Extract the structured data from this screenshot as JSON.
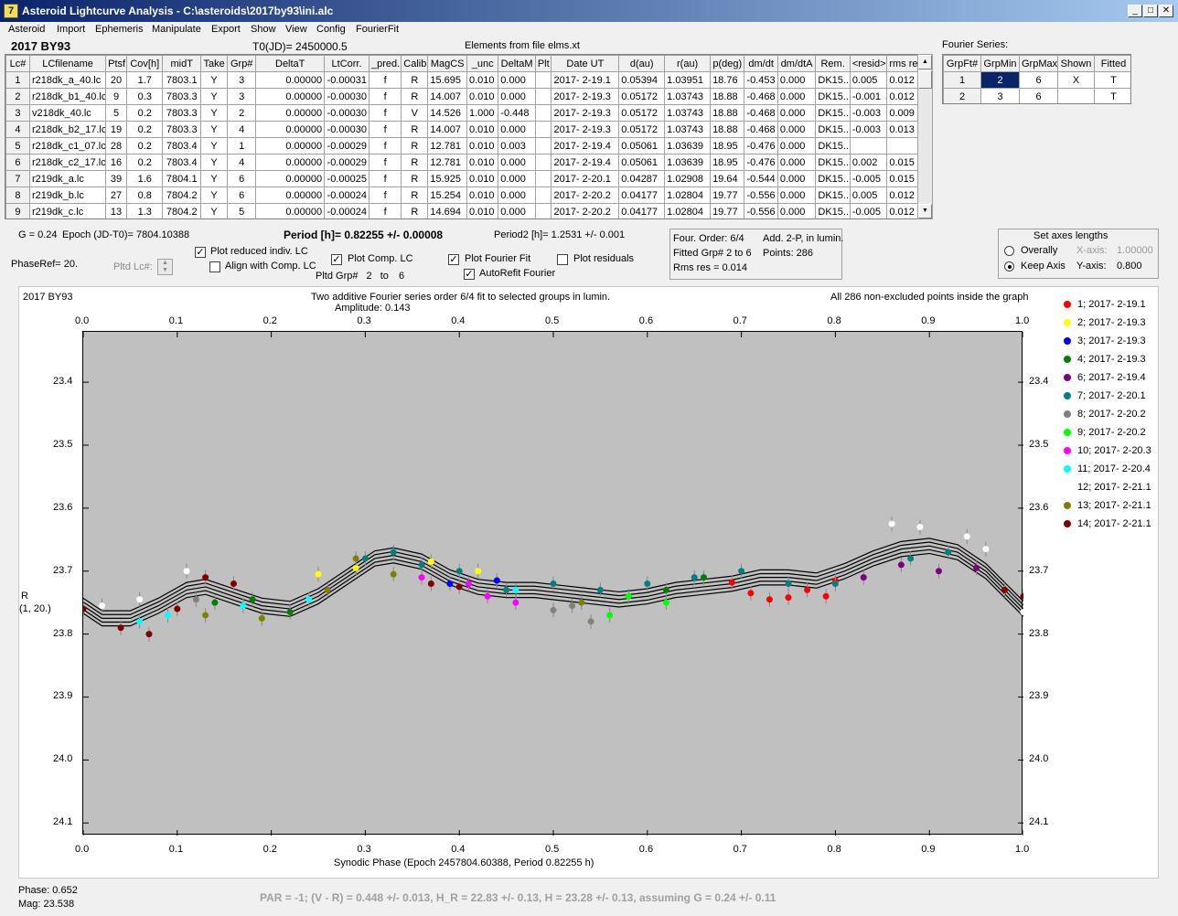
{
  "window": {
    "title": "Asteroid Lightcurve Analysis - C:\\asteroids\\2017by93\\ini.alc",
    "icon_letter": "7"
  },
  "menu": [
    "Asteroid",
    "Import",
    "Ephemeris",
    "Manipulate",
    "Export",
    "Show",
    "View",
    "Config",
    "FourierFit"
  ],
  "header": {
    "object": "2017 BY93",
    "t0": "T0(JD)= 2450000.5",
    "elements": "Elements from file elms.xt",
    "fourier_series": "Fourier Series:"
  },
  "lc_table": {
    "columns": [
      "Lc#",
      "LCfilename",
      "Ptsf",
      "Cov[h]",
      "midT",
      "Take",
      "Grp#",
      "DeltaT",
      "LtCorr.",
      "_pred.",
      "Calib.",
      "MagCS",
      "_unc",
      "DeltaM",
      "Plt",
      "Date UT",
      "d(au)",
      "r(au)",
      "p(deg)",
      "dm/dt",
      "dm/dtA",
      "Rem.",
      "<resid>",
      "rms res"
    ],
    "rows": [
      [
        "1",
        "r218dk_a_40.lc",
        "20",
        "1.7",
        "7803.1",
        "Y",
        "3",
        "0.00000",
        "-0.00031",
        "f",
        "R",
        "15.695",
        "0.010",
        "0.000",
        "",
        "2017- 2-19.1",
        "0.05394",
        "1.03951",
        "18.76",
        "-0.453",
        "0.000",
        "DK15...",
        "0.005",
        "0.012"
      ],
      [
        "2",
        "r218dk_b1_40.lc",
        "9",
        "0.3",
        "7803.3",
        "Y",
        "3",
        "0.00000",
        "-0.00030",
        "f",
        "R",
        "14.007",
        "0.010",
        "0.000",
        "",
        "2017- 2-19.3",
        "0.05172",
        "1.03743",
        "18.88",
        "-0.468",
        "0.000",
        "DK15...",
        "-0.001",
        "0.012"
      ],
      [
        "3",
        "v218dk_40.lc",
        "5",
        "0.2",
        "7803.3",
        "Y",
        "2",
        "0.00000",
        "-0.00030",
        "f",
        "V",
        "14.526",
        "1.000",
        "-0.448",
        "",
        "2017- 2-19.3",
        "0.05172",
        "1.03743",
        "18.88",
        "-0.468",
        "0.000",
        "DK15...",
        "-0.003",
        "0.009"
      ],
      [
        "4",
        "r218dk_b2_17.lc",
        "19",
        "0.2",
        "7803.3",
        "Y",
        "4",
        "0.00000",
        "-0.00030",
        "f",
        "R",
        "14.007",
        "0.010",
        "0.000",
        "",
        "2017- 2-19.3",
        "0.05172",
        "1.03743",
        "18.88",
        "-0.468",
        "0.000",
        "DK15...",
        "-0.003",
        "0.013"
      ],
      [
        "5",
        "r218dk_c1_07.lc",
        "28",
        "0.2",
        "7803.4",
        "Y",
        "1",
        "0.00000",
        "-0.00029",
        "f",
        "R",
        "12.781",
        "0.010",
        "0.003",
        "",
        "2017- 2-19.4",
        "0.05061",
        "1.03639",
        "18.95",
        "-0.476",
        "0.000",
        "DK15...",
        "",
        ""
      ],
      [
        "6",
        "r218dk_c2_17.lc",
        "16",
        "0.2",
        "7803.4",
        "Y",
        "4",
        "0.00000",
        "-0.00029",
        "f",
        "R",
        "12.781",
        "0.010",
        "0.000",
        "",
        "2017- 2-19.4",
        "0.05061",
        "1.03639",
        "18.95",
        "-0.476",
        "0.000",
        "DK15...",
        "0.002",
        "0.015"
      ],
      [
        "7",
        "r219dk_a.lc",
        "39",
        "1.6",
        "7804.1",
        "Y",
        "6",
        "0.00000",
        "-0.00025",
        "f",
        "R",
        "15.925",
        "0.010",
        "0.000",
        "",
        "2017- 2-20.1",
        "0.04287",
        "1.02908",
        "19.64",
        "-0.544",
        "0.000",
        "DK15...",
        "-0.005",
        "0.015"
      ],
      [
        "8",
        "r219dk_b.lc",
        "27",
        "0.8",
        "7804.2",
        "Y",
        "6",
        "0.00000",
        "-0.00024",
        "f",
        "R",
        "15.254",
        "0.010",
        "0.000",
        "",
        "2017- 2-20.2",
        "0.04177",
        "1.02804",
        "19.77",
        "-0.556",
        "0.000",
        "DK15...",
        "0.005",
        "0.012"
      ],
      [
        "9",
        "r219dk_c.lc",
        "13",
        "1.3",
        "7804.2",
        "Y",
        "5",
        "0.00000",
        "-0.00024",
        "f",
        "R",
        "14.694",
        "0.010",
        "0.000",
        "",
        "2017- 2-20.2",
        "0.04177",
        "1.02804",
        "19.77",
        "-0.556",
        "0.000",
        "DK15...",
        "-0.005",
        "0.012"
      ]
    ]
  },
  "fourier_table": {
    "columns": [
      "GrpFt#",
      "GrpMin",
      "GrpMax",
      "Shown",
      "Fitted"
    ],
    "rows": [
      [
        "1",
        "2",
        "6",
        "X",
        "T"
      ],
      [
        "2",
        "3",
        "6",
        "",
        "T"
      ]
    ]
  },
  "controls": {
    "g_value": "G = 0.24",
    "epoch": "Epoch (JD-T0)= 7804.10388",
    "period": "Period [h]= 0.82255 +/- 0.00008",
    "period2": "Period2 [h]= 1.2531 +/- 0.001",
    "phase_ref": "PhaseRef= 20.",
    "pltd_lc": "Pltd Lc#:",
    "plot_reduced": "Plot reduced indiv. LC",
    "align_comp": "Align with Comp. LC",
    "plot_comp": "Plot Comp. LC",
    "pltd_grp": "Pltd Grp#",
    "grp_from": "2",
    "grp_to_word": "to",
    "grp_to": "6",
    "plot_fourier": "Plot Fourier Fit",
    "autorefit": "AutoRefit Fourier",
    "plot_residuals": "Plot residuals",
    "checked": {
      "plot_reduced": true,
      "align_comp": false,
      "plot_comp": true,
      "plot_fourier": true,
      "autorefit": true,
      "plot_residuals": false
    }
  },
  "fit_info": {
    "four_order": "Four. Order:  6/4",
    "add": "Add. 2-P, in lumin.",
    "fitted_grp": "Fitted Grp# 2 to 6",
    "points": "Points: 286",
    "rms": "Rms res     = 0.014"
  },
  "axes_box": {
    "title": "Set axes lengths",
    "overally": "Overally",
    "keep_axis": "Keep Axis",
    "x_axis_label": "X-axis:",
    "x_axis_value": "1.00000",
    "y_axis_label": "Y-axis:",
    "y_axis_value": "0.800",
    "selected": "keep_axis"
  },
  "plot": {
    "object": "2017 BY93",
    "subtitle": "Two additive Fourier series order 6/4 fit to selected groups in lumin.",
    "amplitude": "Amplitude: 0.143",
    "points_note": "All 286 non-excluded points inside the graph",
    "y_label": "R",
    "y_label2": "(1, 20.)",
    "x_label": "Synodic Phase (Epoch 2457804.60388, Period 0.82255 h)",
    "x_ticks": [
      "0.0",
      "0.1",
      "0.2",
      "0.3",
      "0.4",
      "0.5",
      "0.6",
      "0.7",
      "0.8",
      "0.9",
      "1.0"
    ],
    "y_ticks": [
      "23.4",
      "23.5",
      "23.6",
      "23.7",
      "23.8",
      "23.9",
      "24.0",
      "24.1"
    ],
    "legend": [
      {
        "label": "1; 2017- 2-19.1",
        "color": "#ff0000"
      },
      {
        "label": "2; 2017- 2-19.3",
        "color": "#ffff00"
      },
      {
        "label": "3; 2017- 2-19.3",
        "color": "#0000ff"
      },
      {
        "label": "4; 2017- 2-19.3",
        "color": "#008000"
      },
      {
        "label": "6; 2017- 2-19.4",
        "color": "#800080"
      },
      {
        "label": "7; 2017- 2-20.1",
        "color": "#008080"
      },
      {
        "label": "8; 2017- 2-20.2",
        "color": "#808080"
      },
      {
        "label": "9; 2017- 2-20.2",
        "color": "#00ff00"
      },
      {
        "label": "10; 2017- 2-20.3",
        "color": "#ff00ff"
      },
      {
        "label": "11; 2017- 2-20.4",
        "color": "#00ffff"
      },
      {
        "label": "12; 2017- 2-21.1",
        "color": "#ffffff"
      },
      {
        "label": "13; 2017- 2-21.1",
        "color": "#808000"
      },
      {
        "label": "14; 2017- 2-21.1",
        "color": "#800000"
      }
    ]
  },
  "chart_data": {
    "type": "scatter",
    "xlabel": "Synodic Phase (Epoch 2457804.60388, Period 0.82255 h)",
    "ylabel": "R",
    "xlim": [
      0.0,
      1.0
    ],
    "ylim": [
      24.12,
      23.32
    ],
    "y_inverted": true,
    "fit_curve": {
      "x": [
        0.0,
        0.02,
        0.05,
        0.08,
        0.11,
        0.13,
        0.16,
        0.19,
        0.22,
        0.25,
        0.28,
        0.31,
        0.33,
        0.36,
        0.39,
        0.42,
        0.45,
        0.48,
        0.51,
        0.54,
        0.57,
        0.6,
        0.63,
        0.66,
        0.69,
        0.72,
        0.75,
        0.78,
        0.81,
        0.84,
        0.87,
        0.9,
        0.93,
        0.96,
        0.98,
        1.0
      ],
      "y": [
        23.755,
        23.775,
        23.775,
        23.755,
        23.73,
        23.725,
        23.74,
        23.755,
        23.76,
        23.74,
        23.71,
        23.68,
        23.675,
        23.685,
        23.71,
        23.725,
        23.73,
        23.73,
        23.735,
        23.74,
        23.745,
        23.74,
        23.73,
        23.725,
        23.72,
        23.71,
        23.71,
        23.715,
        23.7,
        23.68,
        23.665,
        23.66,
        23.67,
        23.7,
        23.73,
        23.76
      ]
    },
    "series": [
      {
        "name": "1; 2017- 2-19.1",
        "color": "#ff0000",
        "x": [
          0.69,
          0.71,
          0.73,
          0.75,
          0.77,
          0.79,
          0.8
        ],
        "y": [
          23.718,
          23.735,
          23.745,
          23.742,
          23.73,
          23.74,
          23.715
        ]
      },
      {
        "name": "2; 2017- 2-19.3",
        "color": "#ffff00",
        "x": [
          0.25,
          0.29,
          0.37,
          0.42
        ],
        "y": [
          23.705,
          23.695,
          23.685,
          23.7
        ]
      },
      {
        "name": "3; 2017- 2-19.3",
        "color": "#0000ff",
        "x": [
          0.39,
          0.44
        ],
        "y": [
          23.72,
          23.715
        ]
      },
      {
        "name": "4; 2017- 2-19.3",
        "color": "#008000",
        "x": [
          0.14,
          0.18,
          0.22,
          0.62,
          0.66
        ],
        "y": [
          23.75,
          23.745,
          23.765,
          23.73,
          23.71
        ]
      },
      {
        "name": "6; 2017- 2-19.4",
        "color": "#800080",
        "x": [
          0.83,
          0.87,
          0.91,
          0.95
        ],
        "y": [
          23.71,
          23.69,
          23.7,
          23.695
        ]
      },
      {
        "name": "7; 2017- 2-20.1",
        "color": "#008080",
        "x": [
          0.3,
          0.33,
          0.36,
          0.4,
          0.45,
          0.5,
          0.55,
          0.6,
          0.65,
          0.7,
          0.75,
          0.8,
          0.88,
          0.92
        ],
        "y": [
          23.68,
          23.67,
          23.69,
          23.7,
          23.73,
          23.72,
          23.73,
          23.72,
          23.71,
          23.7,
          23.72,
          23.72,
          23.68,
          23.67
        ]
      },
      {
        "name": "8; 2017- 2-20.2",
        "color": "#808080",
        "x": [
          0.12,
          0.5,
          0.52,
          0.54
        ],
        "y": [
          23.745,
          23.762,
          23.755,
          23.78
        ]
      },
      {
        "name": "9; 2017- 2-20.2",
        "color": "#00ff00",
        "x": [
          0.56,
          0.58,
          0.62
        ],
        "y": [
          23.77,
          23.74,
          23.75
        ]
      },
      {
        "name": "10; 2017- 2-20.3",
        "color": "#ff00ff",
        "x": [
          0.36,
          0.41,
          0.43,
          0.46
        ],
        "y": [
          23.71,
          23.72,
          23.74,
          23.75
        ]
      },
      {
        "name": "11; 2017- 2-20.4",
        "color": "#00ffff",
        "x": [
          0.06,
          0.09,
          0.17,
          0.24,
          0.46
        ],
        "y": [
          23.78,
          23.77,
          23.755,
          23.745,
          23.73
        ]
      },
      {
        "name": "12; 2017- 2-21.1",
        "color": "#ffffff",
        "x": [
          0.02,
          0.06,
          0.11,
          0.86,
          0.89,
          0.94,
          0.96,
          1.0
        ],
        "y": [
          23.755,
          23.745,
          23.7,
          23.625,
          23.63,
          23.645,
          23.665,
          23.765
        ]
      },
      {
        "name": "13; 2017- 2-21.1",
        "color": "#808000",
        "x": [
          0.13,
          0.19,
          0.26,
          0.29,
          0.33,
          0.53
        ],
        "y": [
          23.77,
          23.775,
          23.73,
          23.68,
          23.705,
          23.75
        ]
      },
      {
        "name": "14; 2017- 2-21.1",
        "color": "#800000",
        "x": [
          0.0,
          0.04,
          0.07,
          0.1,
          0.13,
          0.16,
          0.37,
          0.4,
          0.98,
          1.0
        ],
        "y": [
          23.76,
          23.79,
          23.8,
          23.76,
          23.71,
          23.72,
          23.72,
          23.725,
          23.73,
          23.74
        ]
      }
    ],
    "legend": "right"
  },
  "status": {
    "phase": "Phase:  0.652",
    "mag": "Mag:    23.538",
    "par": "PAR = -1; (V - R) = 0.448 +/- 0.013, H_R = 22.83 +/- 0.13, H = 23.28 +/- 0.13, assuming G = 0.24 +/- 0.11"
  }
}
